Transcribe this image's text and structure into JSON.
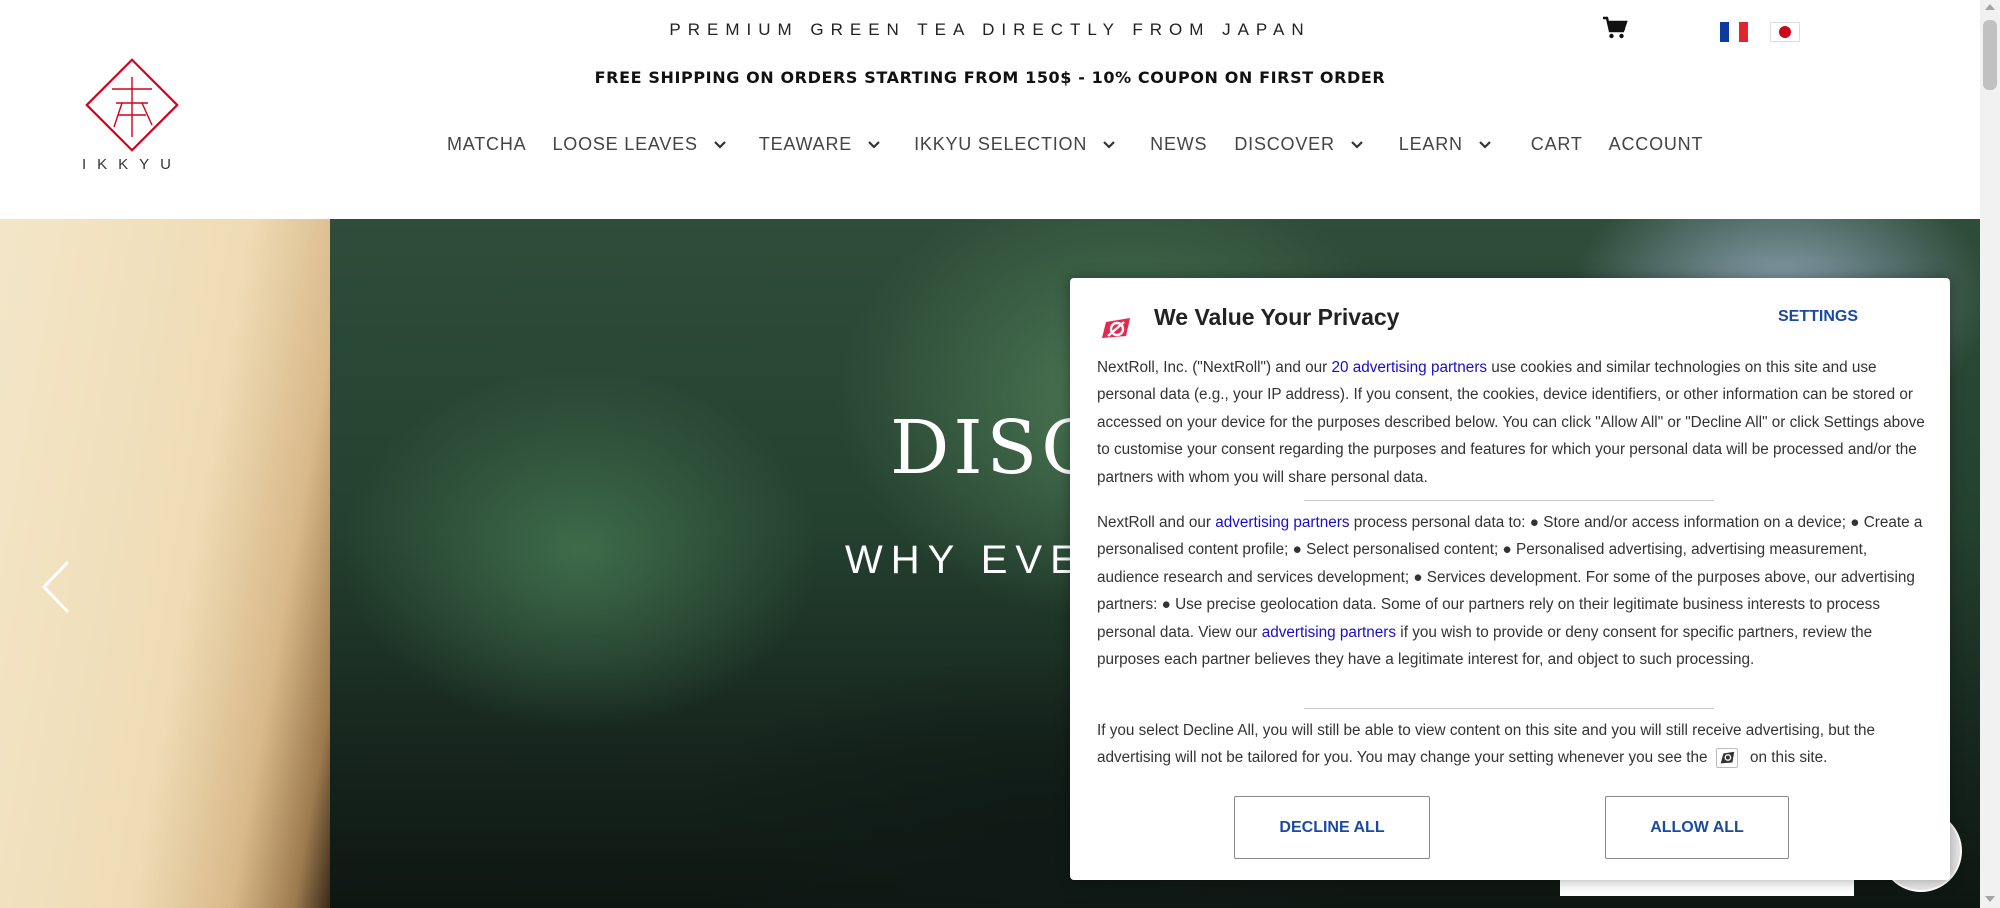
{
  "header": {
    "tagline": "PREMIUM GREEN TEA DIRECTLY FROM JAPAN",
    "shipping_banner": "FREE SHIPPING ON ORDERS STARTING FROM 150$ - 10% COUPON ON FIRST ORDER",
    "logo_text": "IKKYU",
    "nav": [
      {
        "label": "MATCHA"
      },
      {
        "label": "LOOSE LEAVES"
      },
      {
        "label": "TEAWARE"
      },
      {
        "label": "IKKYU SELECTION"
      },
      {
        "label": "NEWS"
      },
      {
        "label": "DISCOVER"
      },
      {
        "label": "LEARN"
      },
      {
        "label": "CART"
      },
      {
        "label": "ACCOUNT"
      }
    ]
  },
  "hero": {
    "title": "DISC",
    "subtitle": "WHY EVE"
  },
  "consent": {
    "title": "We Value Your Privacy",
    "settings_label": "SETTINGS",
    "p1_a": "NextRoll, Inc. (\"NextRoll\") and our ",
    "p1_link": "20 advertising partners",
    "p1_b": " use cookies and similar technologies on this site and use personal data (e.g., your IP address). If you consent, the cookies, device identifiers, or other information can be stored or accessed on your device for the purposes described below. You can click \"Allow All\" or \"Decline All\" or click Settings above to customise your consent regarding the purposes and features for which your personal data will be processed and/or the partners with whom you will share personal data.",
    "p2_a": "NextRoll and our ",
    "p2_link1": "advertising partners",
    "p2_b": " process personal data to: ● Store and/or access information on a device; ● Create a personalised content profile; ● Select personalised content; ● Personalised advertising, advertising measurement, audience research and services development; ● Services development. For some of the purposes above, our advertising partners: ● Use precise geolocation data. Some of our partners rely on their legitimate business interests to process personal data. View our ",
    "p2_link2": "advertising partners",
    "p2_c": " if you wish to provide or deny consent for specific partners, review the purposes each partner believes they have a legitimate interest for, and object to such processing.",
    "p3_a": "If you select Decline All, you will still be able to view content on this site and you will still receive advertising, but the advertising will not be tailored for you. You may change your setting whenever you see the ",
    "p3_b": " on this site.",
    "decline_label": "DECLINE ALL",
    "allow_label": "ALLOW ALL"
  },
  "colors": {
    "accent_red": "#d0021b",
    "consent_blue": "#1b4aa3",
    "link_blue": "#1a0dcc",
    "nextroll_pink": "#e8264f"
  }
}
